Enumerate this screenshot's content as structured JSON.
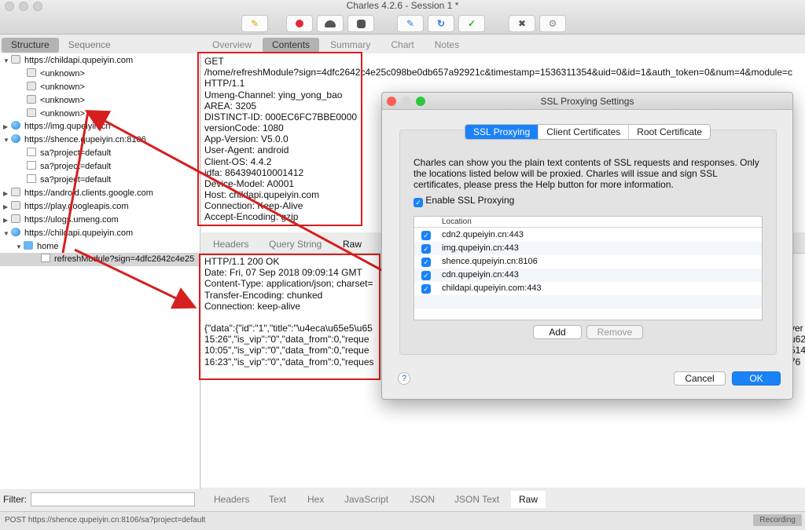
{
  "window": {
    "title": "Charles 4.2.6 - Session 1 *"
  },
  "toolbar": {
    "icons": [
      "broom-icon",
      "record-icon",
      "throttle-icon",
      "stop-icon",
      "pen-icon",
      "refresh-icon",
      "check-icon",
      "tools-icon",
      "settings-icon"
    ]
  },
  "left": {
    "tabs": [
      "Structure",
      "Sequence"
    ],
    "tree": [
      {
        "label": "https://childapi.qupeiyin.com",
        "icon": "lock"
      },
      {
        "label": "<unknown>",
        "icon": "lock"
      },
      {
        "label": "<unknown>",
        "icon": "lock"
      },
      {
        "label": "<unknown>",
        "icon": "lock"
      },
      {
        "label": "<unknown>",
        "icon": "lock"
      },
      {
        "label": "https://img.qupeiyin.cn",
        "icon": "globe"
      },
      {
        "label": "https://shence.qupeiyin.cn:8106",
        "icon": "globe"
      },
      {
        "label": "sa?project=default",
        "icon": "doc"
      },
      {
        "label": "sa?project=default",
        "icon": "doc"
      },
      {
        "label": "sa?project=default",
        "icon": "doc"
      },
      {
        "label": "https://android.clients.google.com",
        "icon": "lock"
      },
      {
        "label": "https://play.googleapis.com",
        "icon": "lock"
      },
      {
        "label": "https://ulogs.umeng.com",
        "icon": "lock"
      },
      {
        "label": "https://childapi.qupeiyin.com",
        "icon": "globe"
      },
      {
        "label": "home",
        "icon": "folder"
      },
      {
        "label": "refreshModule?sign=4dfc2642c4e25",
        "icon": "doc"
      }
    ],
    "filter_label": "Filter:"
  },
  "right": {
    "tabs": [
      "Overview",
      "Contents",
      "Summary",
      "Chart",
      "Notes"
    ],
    "request_lines": [
      "GET",
      "/home/refreshModule?sign=4dfc2642c4e25c098be0db657a92921c&timestamp=1536311354&uid=0&id=1&auth_token=0&num=4&module=c",
      " HTTP/1.1",
      "Umeng-Channel: ying_yong_bao",
      "AREA: 3205",
      "DISTINCT-ID: 000EC6FC7BBE0000",
      "versionCode: 1080",
      "App-Version: V5.0.0",
      "User-Agent: android",
      "Client-OS: 4.4.2",
      "idfa: 864394010001412",
      "Device-Model: A0001",
      "Host: childapi.qupeiyin.com",
      "Connection: Keep-Alive",
      "Accept-Encoding: gzip"
    ],
    "sub_tabs": [
      "Headers",
      "Query String",
      "Raw"
    ],
    "response_lines": [
      "HTTP/1.1 200 OK",
      "Date: Fri, 07 Sep 2018 09:09:14 GMT",
      "Content-Type: application/json; charset=",
      "Transfer-Encoding: chunked",
      "Connection: keep-alive",
      "",
      "{\"data\":{\"id\":\"1\",\"title\":\"\\u4eca\\u65e5\\u65",
      " 15:26\",\"is_vip\":\"0\",\"data_from\":0,\"reque",
      "10:05\",\"is_vip\":\"0\",\"data_from\":0,\"reque",
      "16:23\",\"is_vip\":\"0\",\"data_from\":0,\"reques"
    ],
    "response_overflow": [
      "ver",
      "u62",
      "514",
      "76"
    ],
    "bottom_tabs": [
      "Headers",
      "Text",
      "Hex",
      "JavaScript",
      "JSON",
      "JSON Text",
      "Raw"
    ]
  },
  "status": {
    "text": "POST https://shence.qupeiyin.cn:8106/sa?project=default",
    "recording": "Recording"
  },
  "dialog": {
    "title": "SSL Proxying Settings",
    "tabs": [
      "SSL Proxying",
      "Client Certificates",
      "Root Certificate"
    ],
    "description": "Charles can show you the plain text contents of SSL requests and responses. Only the locations listed below will be proxied. Charles will issue and sign SSL certificates, please press the Help button for more information.",
    "enable_label": "Enable SSL Proxying",
    "check_glyph": "✓",
    "column_header": "Location",
    "locations": [
      "cdn2.qupeiyin.cn:443",
      "img.qupeiyin.cn:443",
      "shence.qupeiyin.cn:8106",
      "cdn.qupeiyin.cn:443",
      "childapi.qupeiyin.com:443"
    ],
    "add": "Add",
    "remove": "Remove",
    "help": "?",
    "cancel": "Cancel",
    "ok": "OK"
  },
  "colors": {
    "accent": "#1a82f7",
    "annotation": "#d61f1f"
  }
}
